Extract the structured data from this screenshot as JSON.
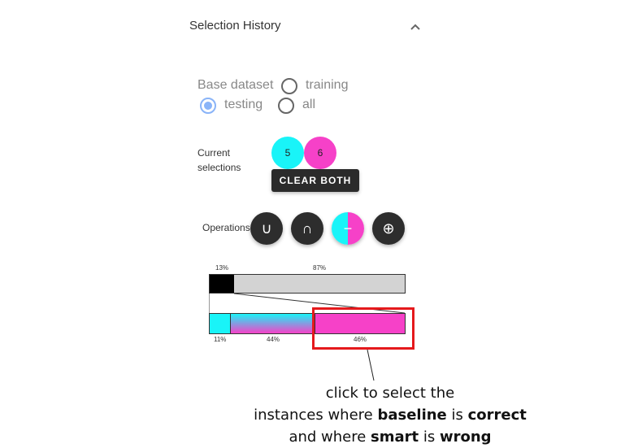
{
  "panel": {
    "title": "Selection History"
  },
  "base_dataset": {
    "label": "Base dataset",
    "options": [
      {
        "label": "training",
        "checked": false
      },
      {
        "label": "testing",
        "checked": true
      },
      {
        "label": "all",
        "checked": false
      }
    ]
  },
  "current_selections": {
    "label": "Current selections",
    "first": {
      "value": "5",
      "color": "#19f4f8"
    },
    "second": {
      "value": "6",
      "color": "#f641c8"
    },
    "clear_label": "CLEAR BOTH"
  },
  "operations": {
    "label": "Operations",
    "union": "∪",
    "intersection": "∩",
    "difference": "−",
    "xor": "⊕"
  },
  "bars": {
    "top": {
      "left_pct": "13%",
      "right_pct": "87%",
      "left_value": 0.13,
      "right_value": 0.87,
      "left_color": "#000000",
      "right_color": "#d3d3d3"
    },
    "bottom": {
      "segments": [
        {
          "label": "11%",
          "value": 0.11,
          "color": "#19f4f8"
        },
        {
          "label": "44%",
          "value": 0.44,
          "color_top": "#19f4f8",
          "color_bottom": "#f641c8"
        },
        {
          "label": "46%",
          "value": 0.46,
          "color": "#f641c8"
        }
      ]
    }
  },
  "annotation": {
    "line1": "click to select the",
    "line2_pre": "instances where ",
    "line2_b1": "baseline",
    "line2_mid": " is ",
    "line2_b2": "correct",
    "line3_pre": "and where ",
    "line3_b1": "smart",
    "line3_mid": " is ",
    "line3_b2": "wrong",
    "highlight_color": "#e5191c"
  }
}
